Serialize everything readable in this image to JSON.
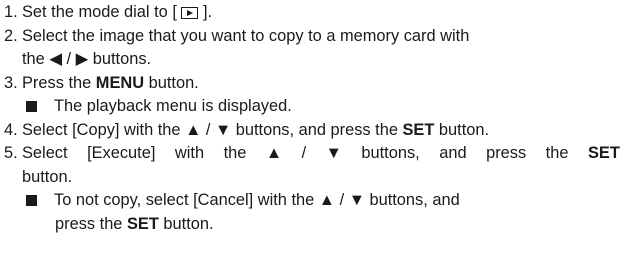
{
  "steps": [
    {
      "num": "1.",
      "pre": "Set the mode dial to [ ",
      "icon": "playback-mode-icon",
      "post": " ]."
    },
    {
      "num": "2.",
      "line1": "Select the image that you want to copy to a memory card with",
      "line2": "the ◀ / ▶ buttons."
    },
    {
      "num": "3.",
      "pre": "Press the ",
      "bold": "MENU",
      "post": " button.",
      "note": "The playback menu is displayed."
    },
    {
      "num": "4.",
      "pre": "Select [Copy] with the ▲ / ▼ buttons, and press the ",
      "bold": "SET",
      "post": " button."
    },
    {
      "num": "5.",
      "words": [
        "Select",
        "[Execute]",
        "with",
        "the",
        "▲",
        "/",
        "▼",
        "buttons,",
        "and",
        "press",
        "the"
      ],
      "bold": "SET",
      "line2": "button.",
      "note_line1": "To not copy, select [Cancel] with the ▲ / ▼ buttons, and",
      "note_line2_pre": "press the ",
      "note_line2_bold": "SET",
      "note_line2_post": " button."
    }
  ]
}
